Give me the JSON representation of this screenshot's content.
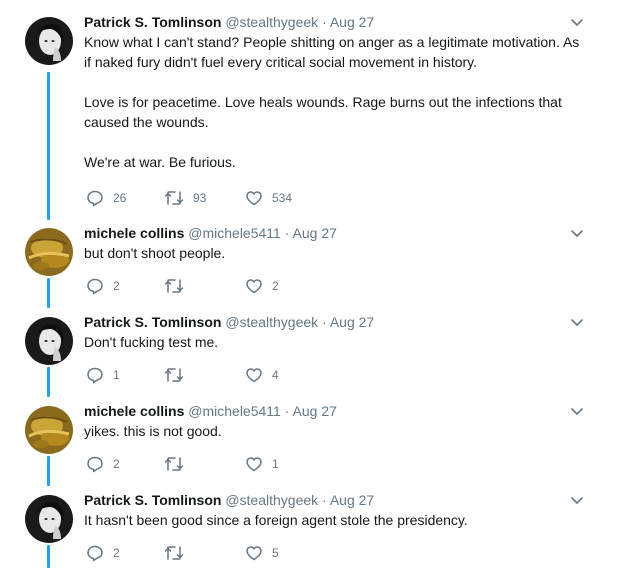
{
  "tweets": [
    {
      "author": "Patrick S. Tomlinson",
      "handle": "@stealthygeek",
      "separator": "·",
      "date": "Aug 27",
      "paragraphs": [
        "Know what I can't stand? People shitting on anger as a legitimate motivation. As if naked fury didn't fuel every critical social movement in history.",
        "Love is for peacetime. Love heals wounds. Rage burns out the infections that caused the wounds.",
        "We're at war. Be furious."
      ],
      "replies": "26",
      "retweets": "93",
      "likes": "534"
    },
    {
      "author": "michele collins",
      "handle": "@michele5411",
      "separator": "·",
      "date": "Aug 27",
      "paragraphs": [
        "but don't shoot people."
      ],
      "replies": "2",
      "retweets": "",
      "likes": "2"
    },
    {
      "author": "Patrick S. Tomlinson",
      "handle": "@stealthygeek",
      "separator": "·",
      "date": "Aug 27",
      "paragraphs": [
        "Don't fucking test me."
      ],
      "replies": "1",
      "retweets": "",
      "likes": "4"
    },
    {
      "author": "michele collins",
      "handle": "@michele5411",
      "separator": "·",
      "date": "Aug 27",
      "paragraphs": [
        "yikes. this is not good."
      ],
      "replies": "2",
      "retweets": "",
      "likes": "1"
    },
    {
      "author": "Patrick S. Tomlinson",
      "handle": "@stealthygeek",
      "separator": "·",
      "date": "Aug 27",
      "paragraphs": [
        "It hasn't been good since a foreign agent stole the presidency."
      ],
      "replies": "2",
      "retweets": "",
      "likes": "5"
    }
  ],
  "icons": {
    "reply": "reply-icon",
    "retweet": "retweet-icon",
    "like": "like-icon",
    "menu": "chevron-down-icon"
  },
  "colors": {
    "thread_line": "#1da1f2",
    "meta_text": "#657786",
    "body_text": "#14171a"
  }
}
